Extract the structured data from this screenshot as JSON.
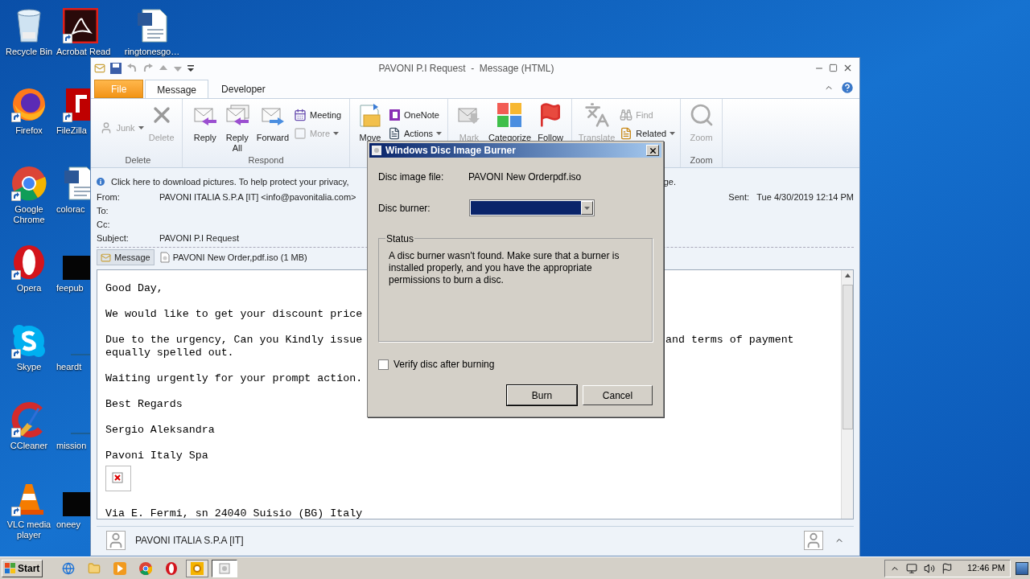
{
  "desktop": {
    "columns": [
      [
        {
          "label": "Recycle Bin",
          "kind": "recycle",
          "shortcut": false
        },
        {
          "label": "Firefox",
          "kind": "firefox",
          "shortcut": true
        },
        {
          "label": "Google Chrome",
          "kind": "chrome",
          "shortcut": true
        },
        {
          "label": "Opera",
          "kind": "opera",
          "shortcut": true
        },
        {
          "label": "Skype",
          "kind": "skype",
          "shortcut": true
        },
        {
          "label": "CCleaner",
          "kind": "ccleaner",
          "shortcut": true
        },
        {
          "label": "VLC media player",
          "kind": "vlc",
          "shortcut": true
        }
      ],
      [
        {
          "label": "Acrobat Read",
          "kind": "acrobat",
          "shortcut": true
        },
        {
          "label": "FileZilla",
          "kind": "filezilla",
          "shortcut": true
        },
        {
          "label": "colorac",
          "kind": "word",
          "shortcut": false
        },
        {
          "label": "feepub",
          "kind": "dark",
          "shortcut": false
        },
        {
          "label": "heardt",
          "kind": "blank",
          "shortcut": false
        },
        {
          "label": "mission",
          "kind": "blank",
          "shortcut": false
        },
        {
          "label": "oneey",
          "kind": "dark",
          "shortcut": false
        }
      ],
      [
        {
          "label": "ringtonesgo…",
          "kind": "word",
          "shortcut": false
        }
      ]
    ]
  },
  "window": {
    "title": "PAVONI P.I Request  -  Message (HTML)",
    "tabs": [
      {
        "label": "File",
        "kind": "file",
        "selected": false
      },
      {
        "label": "Message",
        "kind": "tab",
        "selected": true
      },
      {
        "label": "Developer",
        "kind": "tab",
        "selected": false
      }
    ],
    "ribbon": [
      {
        "label": "Delete",
        "items": [
          {
            "kind": "stack",
            "buttons": [
              {
                "label": "Junk",
                "disabled": true,
                "dropdown": true
              }
            ]
          },
          {
            "kind": "large",
            "label": "Delete",
            "disabled": true,
            "dropdown": false
          }
        ]
      },
      {
        "label": "Respond",
        "items": [
          {
            "kind": "large",
            "label": "Reply",
            "disabled": false,
            "dropdown": false
          },
          {
            "kind": "large",
            "label": "Reply\nAll",
            "disabled": false,
            "dropdown": false
          },
          {
            "kind": "large",
            "label": "Forward",
            "disabled": false,
            "dropdown": false
          },
          {
            "kind": "stack",
            "buttons": [
              {
                "label": "Meeting",
                "disabled": false,
                "dropdown": false
              },
              {
                "label": "More",
                "disabled": true,
                "dropdown": true
              }
            ]
          }
        ]
      },
      {
        "items": [
          {
            "kind": "large",
            "label": "Move",
            "disabled": false,
            "dropdown": false
          },
          {
            "kind": "stack",
            "buttons": [
              {
                "label": "OneNote",
                "disabled": false,
                "dropdown": false
              },
              {
                "label": "Actions",
                "disabled": false,
                "dropdown": true
              }
            ]
          }
        ]
      },
      {
        "items": [
          {
            "kind": "large",
            "label": "Mark",
            "disabled": true,
            "dropdown": false
          },
          {
            "kind": "large",
            "label": "Categorize",
            "disabled": false,
            "dropdown": false
          },
          {
            "kind": "large",
            "label": "Follow",
            "disabled": false,
            "dropdown": false
          }
        ]
      },
      {
        "items": [
          {
            "kind": "large",
            "label": "Translate",
            "disabled": true,
            "dropdown": false
          },
          {
            "kind": "stack",
            "buttons": [
              {
                "label": "Find",
                "disabled": true,
                "dropdown": false
              },
              {
                "label": "Related",
                "disabled": false,
                "dropdown": true
              }
            ]
          }
        ]
      },
      {
        "label": "Zoom",
        "items": [
          {
            "kind": "large",
            "label": "Zoom",
            "disabled": true,
            "dropdown": false
          }
        ]
      }
    ],
    "infobar": {
      "text": "Click here to download pictures. To help protect your privacy,",
      "tail": "ge."
    },
    "header": {
      "fields": [
        {
          "label": "From:",
          "value": "PAVONI ITALIA S.P.A [IT] <info@pavonitalia.com>"
        },
        {
          "label": "To:"
        },
        {
          "label": "Cc:"
        },
        {
          "label": "Subject:",
          "value": "PAVONI P.I Request"
        }
      ],
      "sent": {
        "label": "Sent:",
        "value": "Tue 4/30/2019 12:14 PM"
      }
    },
    "attachments": [
      {
        "label": "Message",
        "kind": "message",
        "selected": true
      },
      {
        "label": "PAVONI New Order,pdf.iso (1 MB)",
        "kind": "file",
        "selected": false
      }
    ],
    "body": [
      {
        "kind": "text",
        "lines": [
          {
            "text": "Good Day,"
          }
        ]
      },
      {
        "kind": "text",
        "lines": [
          {
            "text": "We would like to get your discount price"
          }
        ]
      },
      {
        "kind": "text",
        "lines": [
          {
            "text": "Due to the urgency, Can you Kindly issue",
            "tail": "and terms of payment"
          },
          {
            "text": "equally spelled out."
          }
        ]
      },
      {
        "kind": "text",
        "lines": [
          {
            "text": "Waiting urgently for your prompt action."
          }
        ]
      },
      {
        "kind": "text",
        "lines": [
          {
            "text": "Best Regards"
          }
        ]
      },
      {
        "kind": "text",
        "lines": [
          {
            "text": "Sergio Aleksandra"
          }
        ]
      },
      {
        "kind": "text",
        "lines": [
          {
            "text": "Pavoni Italy Spa"
          }
        ]
      },
      {
        "kind": "image"
      },
      {
        "kind": "text",
        "lines": [
          {
            "text": "Via E. Fermi, sn 24040 Suisio (BG) Italy"
          }
        ]
      }
    ],
    "people_pane": {
      "name": "PAVONI ITALIA S.P.A [IT]"
    }
  },
  "dialog": {
    "title": "Windows Disc Image Burner",
    "fields": [
      {
        "label": "Disc image file:",
        "value": "PAVONI New Orderpdf.iso"
      }
    ],
    "burner": {
      "label": "Disc burner:"
    },
    "status": {
      "title": "Status",
      "text": "A disc burner wasn't found. Make sure that a burner is installed properly, and you have the appropriate permissions to burn a disc."
    },
    "verify": {
      "label": "Verify disc after burning",
      "checked": false
    },
    "buttons": [
      {
        "label": "Burn",
        "default": true
      },
      {
        "label": "Cancel",
        "default": false
      }
    ]
  },
  "taskbar": {
    "start": "Start",
    "apps": [
      {
        "kind": "ie",
        "active": false
      },
      {
        "kind": "folder",
        "active": false
      },
      {
        "kind": "media",
        "active": false
      },
      {
        "kind": "chrome",
        "active": false
      },
      {
        "kind": "opera",
        "active": false
      },
      {
        "kind": "outlook",
        "active": true
      },
      {
        "kind": "window",
        "active": true
      }
    ],
    "clock": "12:46 PM"
  }
}
